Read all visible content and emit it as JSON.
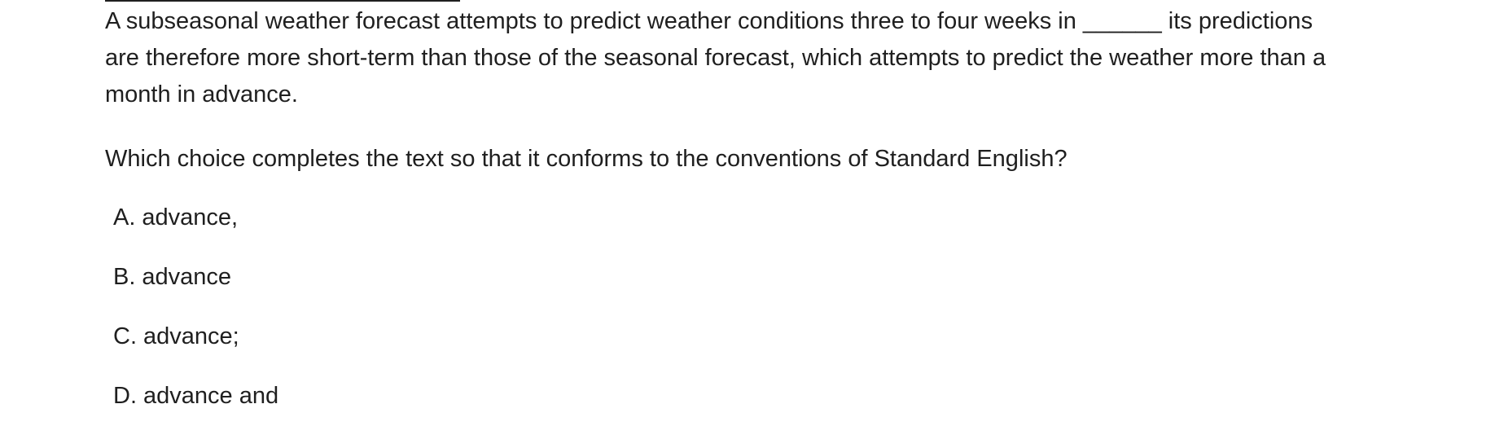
{
  "passage": {
    "text": "A subseasonal weather forecast attempts to predict weather conditions three to four weeks in ______ its predictions are therefore more short-term than those of the seasonal forecast, which attempts to predict the weather more than a month in advance."
  },
  "question": {
    "text": "Which choice completes the text so that it conforms to the conventions of Standard English?"
  },
  "choices": [
    {
      "letter": "A",
      "sep": ".",
      "text": "advance,"
    },
    {
      "letter": "B",
      "sep": ".",
      "text": "advance"
    },
    {
      "letter": "C",
      "sep": ".",
      "text": "advance;"
    },
    {
      "letter": "D",
      "sep": ".",
      "text": "advance and"
    }
  ]
}
